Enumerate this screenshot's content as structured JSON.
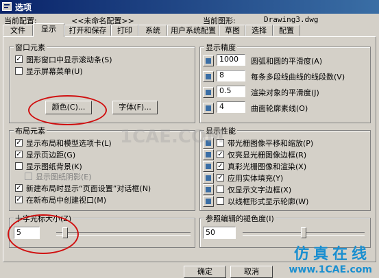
{
  "window": {
    "title": "选项"
  },
  "header": {
    "current_config_label": "当前配置:",
    "current_config_value": "<<未命名配置>>",
    "current_drawing_label": "当前图形:",
    "current_drawing_value": "Drawing3.dwg"
  },
  "tabs": [
    "文件",
    "显示",
    "打开和保存",
    "打印",
    "系统",
    "用户系统配置",
    "草图",
    "选择",
    "配置"
  ],
  "window_elements": {
    "title": "窗口元素",
    "checkboxes": [
      {
        "label": "图形窗口中显示滚动条(S)",
        "checked": true
      },
      {
        "label": "显示屏幕菜单(U)",
        "checked": false
      }
    ],
    "colors_button": "颜色(C)...",
    "fonts_button": "字体(F)..."
  },
  "layout_elements": {
    "title": "布局元素",
    "checkboxes": [
      {
        "label": "显示布局和模型选项卡(L)",
        "checked": true
      },
      {
        "label": "显示页边距(G)",
        "checked": true
      },
      {
        "label": "显示图纸背景(K)",
        "checked": false
      },
      {
        "label": "显示图纸阴影(E)",
        "checked": false,
        "disabled": true
      },
      {
        "label": "新建布局时显示“页面设置”对话框(N)",
        "checked": true
      },
      {
        "label": "在新布局中创建视口(M)",
        "checked": true
      }
    ]
  },
  "crosshair": {
    "title": "十字光标大小(Z)",
    "value": "5",
    "slider_fraction": 0.05
  },
  "display_resolution": {
    "title": "显示精度",
    "rows": [
      {
        "value": "1000",
        "label": "圆弧和圆的平滑度(A)"
      },
      {
        "value": "8",
        "label": "每条多段线曲线的线段数(V)"
      },
      {
        "value": "0.5",
        "label": "渲染对象的平滑度(J)"
      },
      {
        "value": "4",
        "label": "曲面轮廓素线(O)"
      }
    ]
  },
  "display_performance": {
    "title": "显示性能",
    "checkboxes": [
      {
        "label": "带光栅图像平移和缩放(P)",
        "checked": false
      },
      {
        "label": "仅亮显光栅图像边框(R)",
        "checked": true
      },
      {
        "label": "真彩光栅图像和渲染(X)",
        "checked": true
      },
      {
        "label": "应用实体填充(Y)",
        "checked": true
      },
      {
        "label": "仅显示文字边框(X)",
        "checked": false
      },
      {
        "label": "以线框形式显示轮廓(W)",
        "checked": false
      }
    ]
  },
  "xref_fade": {
    "title": "参照编辑的褪色度(I)",
    "value": "50",
    "slider_fraction": 0.5
  },
  "footer": {
    "ok_button": "确定",
    "cancel_button": "取消"
  },
  "watermarks": {
    "center": "1CAE.COM",
    "site_cn": "仿真在线",
    "site_url": "www.1CAE.com"
  },
  "colors": {
    "accent": "#d01010",
    "titlebar": "#0a246a",
    "watermark": "#1a8fd0"
  }
}
